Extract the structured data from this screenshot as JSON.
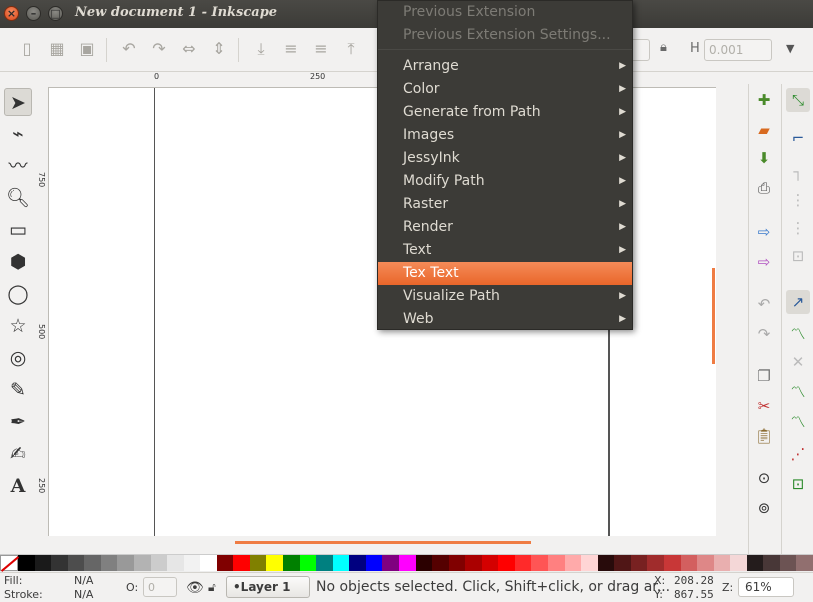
{
  "window": {
    "title": "New document 1 - Inkscape",
    "close_glyph": "×",
    "min_glyph": "–",
    "max_glyph": "□"
  },
  "toolbar": {
    "h_label": "H",
    "h_value": "0.001"
  },
  "rulers": {
    "top_labels": [
      "0",
      "250"
    ],
    "left_labels": [
      "750",
      "500",
      "250"
    ]
  },
  "menu": {
    "items": [
      {
        "label": "Previous Extension",
        "state": "disabled",
        "submenu": false
      },
      {
        "label": "Previous Extension Settings...",
        "state": "disabled",
        "submenu": false
      },
      {
        "label": "Arrange",
        "state": "normal",
        "submenu": true
      },
      {
        "label": "Color",
        "state": "normal",
        "submenu": true
      },
      {
        "label": "Generate from Path",
        "state": "normal",
        "submenu": true
      },
      {
        "label": "Images",
        "state": "normal",
        "submenu": true
      },
      {
        "label": "JessyInk",
        "state": "normal",
        "submenu": true
      },
      {
        "label": "Modify Path",
        "state": "normal",
        "submenu": true
      },
      {
        "label": "Raster",
        "state": "normal",
        "submenu": true
      },
      {
        "label": "Render",
        "state": "normal",
        "submenu": true
      },
      {
        "label": "Text",
        "state": "normal",
        "submenu": true
      },
      {
        "label": "Tex Text",
        "state": "highlighted",
        "submenu": false
      },
      {
        "label": "Visualize Path",
        "state": "normal",
        "submenu": true
      },
      {
        "label": "Web",
        "state": "normal",
        "submenu": true
      }
    ],
    "highlight_color": "#f07746"
  },
  "status": {
    "fill_label": "Fill:",
    "fill_value": "N/A",
    "stroke_label": "Stroke:",
    "stroke_value": "N/A",
    "opacity_label": "O:",
    "opacity_value": "0",
    "layer": "•Layer 1",
    "message": "No objects selected. Click, Shift+click, or drag ar...",
    "x_label": "X:",
    "x_value": "208.28",
    "y_label": "Y:",
    "y_value": "867.55",
    "zoom_label": "Z:",
    "zoom_value": "61%"
  },
  "palette": [
    "#000000",
    "#1a1a1a",
    "#333333",
    "#4d4d4d",
    "#666666",
    "#808080",
    "#999999",
    "#b3b3b3",
    "#cccccc",
    "#e6e6e6",
    "#f2f2f2",
    "#ffffff",
    "#800000",
    "#ff0000",
    "#808000",
    "#ffff00",
    "#008000",
    "#00ff00",
    "#008080",
    "#00ffff",
    "#000080",
    "#0000ff",
    "#800080",
    "#ff00ff",
    "#2b0000",
    "#550000",
    "#800000",
    "#aa0000",
    "#d40000",
    "#ff0000",
    "#ff2a2a",
    "#ff5555",
    "#ff8080",
    "#ffaaaa",
    "#ffd5d5",
    "#280b0b",
    "#501616",
    "#782121",
    "#a02c2c",
    "#c83737",
    "#d35f5f",
    "#de8787",
    "#e9afaf",
    "#f4d7d7",
    "#241c1c",
    "#483737",
    "#6c5353",
    "#916f6f"
  ]
}
